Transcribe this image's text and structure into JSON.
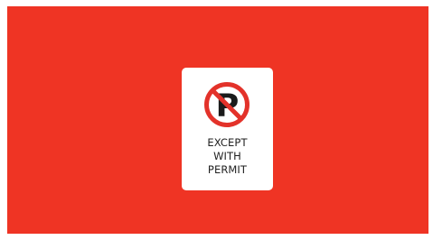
{
  "colors": {
    "background": "#ef3424",
    "card": "#ffffff",
    "icon_red": "#e3322a",
    "icon_dark": "#1b1b1b",
    "text": "#222222"
  },
  "sign": {
    "icon": "no-parking-icon",
    "icon_letter": "P",
    "text_lines": [
      "EXCEPT",
      "WITH",
      "PERMIT"
    ]
  }
}
